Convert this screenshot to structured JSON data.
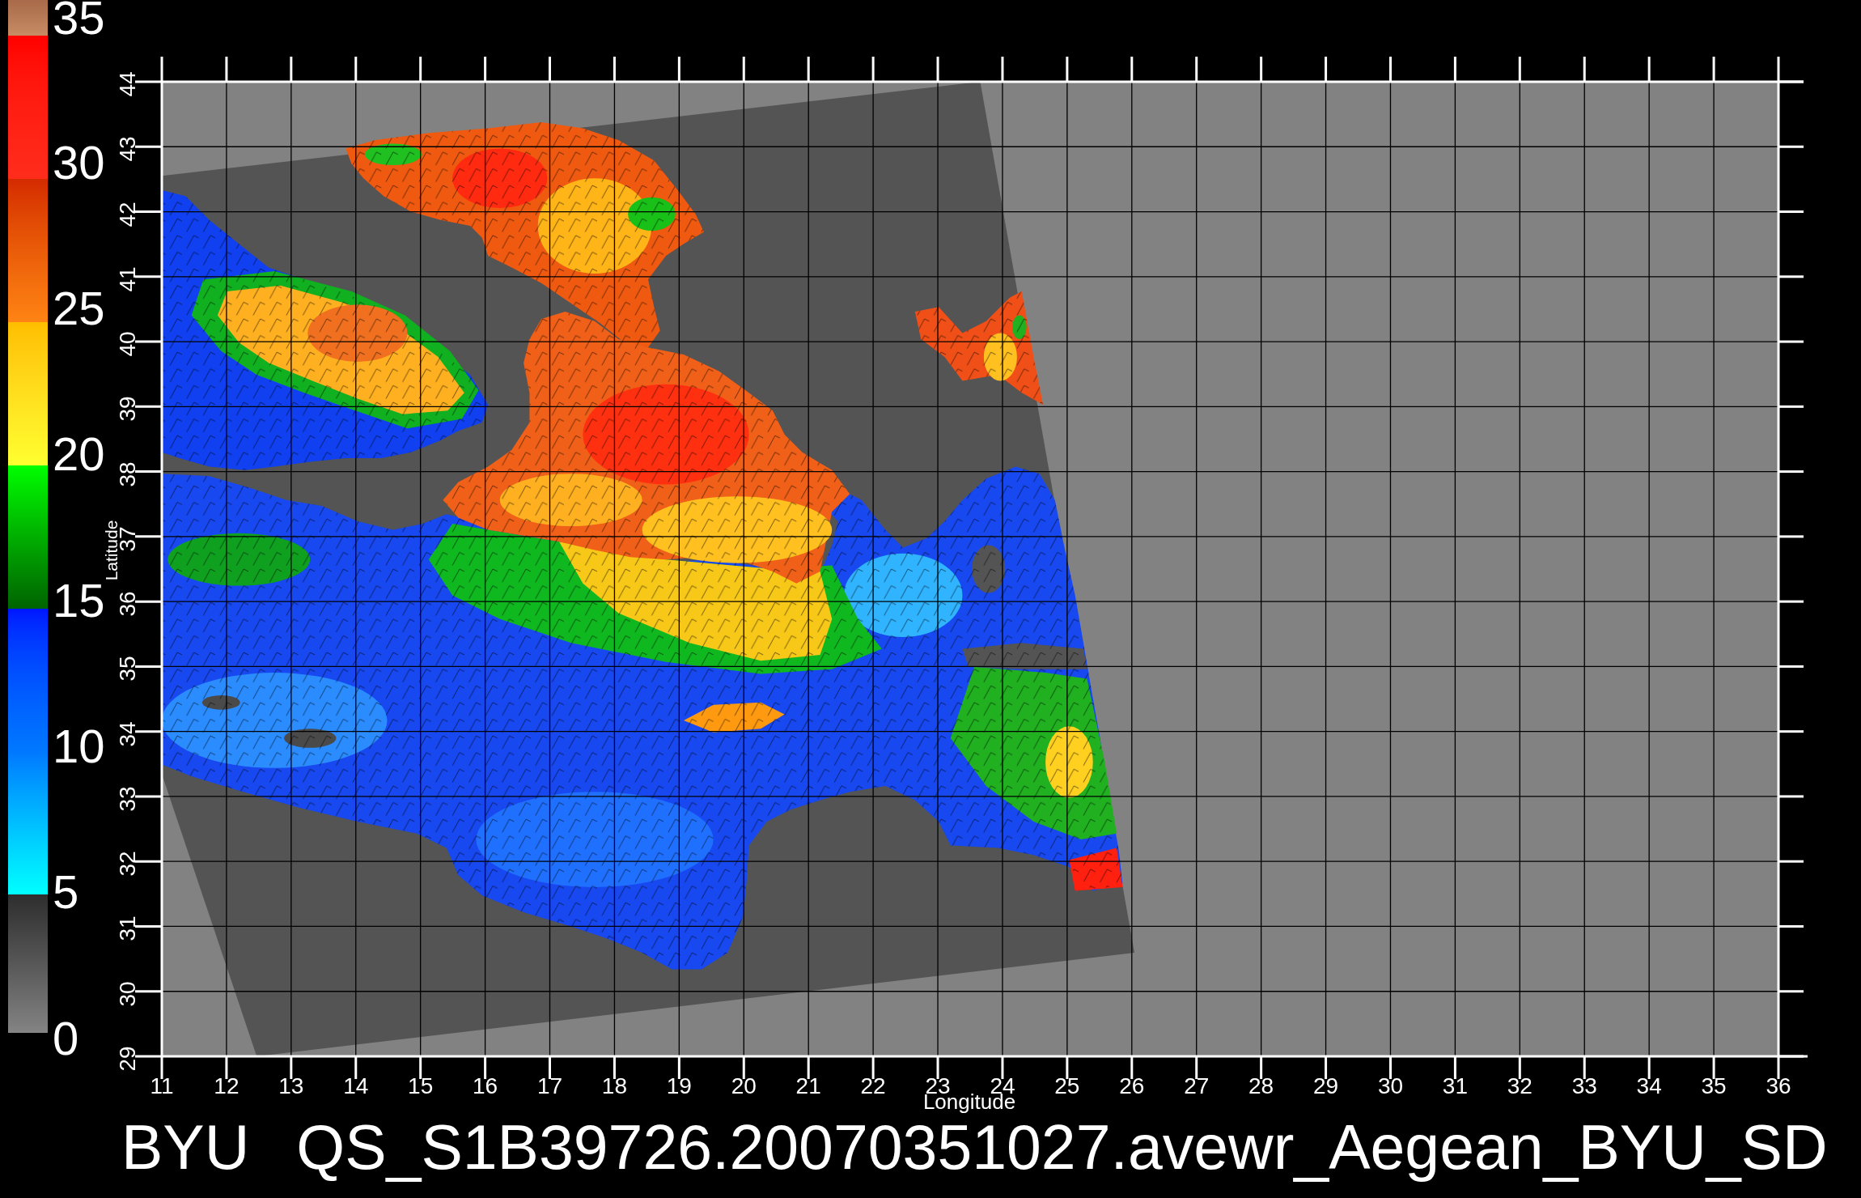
{
  "colorbar": {
    "tick_labels": [
      "35",
      "30",
      "25",
      "20",
      "15",
      "10",
      "5",
      "0"
    ]
  },
  "map": {
    "y_axis": {
      "label": "Latitude",
      "tick_labels": [
        "44",
        "43",
        "42",
        "41",
        "40",
        "39",
        "38",
        "37",
        "36",
        "35",
        "34",
        "33",
        "32",
        "31",
        "30",
        "29"
      ]
    },
    "x_axis": {
      "label": "Longitude",
      "tick_labels": [
        "11",
        "12",
        "13",
        "14",
        "15",
        "16",
        "17",
        "18",
        "19",
        "20",
        "21",
        "22",
        "23",
        "24",
        "25",
        "26",
        "27",
        "28",
        "29",
        "30",
        "31",
        "32",
        "33",
        "34",
        "35",
        "36"
      ]
    }
  },
  "caption": {
    "source": "BYU",
    "filename": "QS_S1B39726.20070351027.avewr_Aegean_BYU_SD"
  }
}
